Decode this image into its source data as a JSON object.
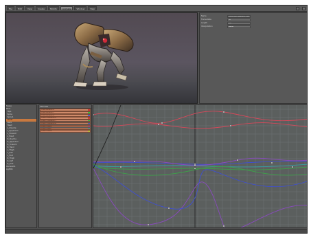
{
  "menu": [
    "File",
    "Edit",
    "View",
    "Create",
    "Modify",
    "Animate",
    "Window",
    "Help"
  ],
  "menu_active_index": 5,
  "properties": [
    {
      "key": "Name",
      "value": "robotmech_skeleton_idle"
    },
    {
      "key": "Frame Rate",
      "value": "30"
    },
    {
      "key": "Length",
      "value": "2.0"
    },
    {
      "key": "Interpolation",
      "value": "Bezier"
    }
  ],
  "tree": {
    "items": [
      "Scene",
      "Root",
      "  Hips",
      "  Spine",
      "  Spine1",
      "  Chest",
      "  Neck",
      "  Head",
      "  L_Clavicle",
      "  L_UpperArm",
      "  L_Forearm",
      "  L_Hand",
      "  R_Clavicle",
      "  R_UpperArm",
      "  R_Forearm",
      "  R_Hand",
      "  L_Thigh",
      "  L_Calf",
      "  L_Foot",
      "  R_Thigh",
      "  R_Calf",
      "  R_Foot",
      "Camera01",
      "Light01"
    ],
    "selected_index": 5
  },
  "channels": {
    "header": "Channels",
    "items": [
      {
        "name": "Chest.Rotation.X",
        "swatch": "#d23b3b"
      },
      {
        "name": "Chest.Rotation.Y",
        "swatch": "#3fbf3f"
      },
      {
        "name": "Chest.Rotation.Z",
        "swatch": "#4a5fd8"
      },
      {
        "name": "Chest.Translation.X",
        "swatch": "#d23b3b"
      },
      {
        "name": "Chest.Translation.Y",
        "swatch": "#3fbf3f"
      },
      {
        "name": "Chest.Translation.Z",
        "swatch": "#4a5fd8"
      },
      {
        "name": "Chest.Scale.X",
        "swatch": "#c94bc9"
      },
      {
        "name": "Chest.Scale.Y",
        "swatch": "#3fbfbf"
      },
      {
        "name": "Chest.Scale.Z",
        "swatch": "#b8b83a"
      }
    ]
  },
  "curve_colors": {
    "red": "#d8485a",
    "blue": "#3f4fd0",
    "cyan": "#35a0a5",
    "green": "#3e9e4a",
    "purple": "#8a4ac0",
    "black": "#202020",
    "grid": "#6f7574",
    "cursor": "#1c1c1c"
  },
  "statusbar": {
    "text": ""
  }
}
